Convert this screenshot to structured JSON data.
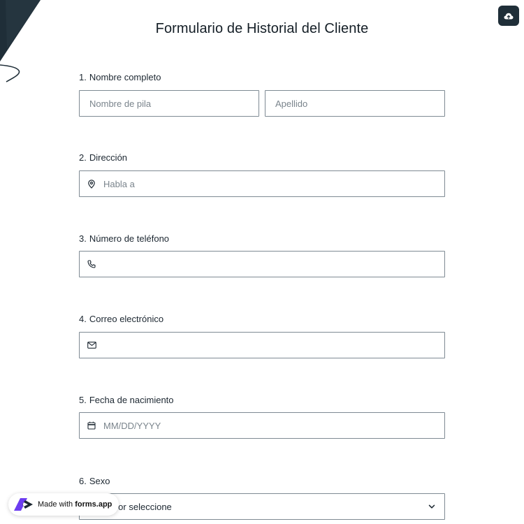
{
  "form": {
    "title": "Formulario de Historial del Cliente",
    "questions": [
      {
        "number": "1.",
        "label": "Nombre completo",
        "first_name_placeholder": "Nombre de pila",
        "last_name_placeholder": "Apellido"
      },
      {
        "number": "2.",
        "label": "Dirección",
        "icon": "location-pin-icon",
        "placeholder": "Habla a"
      },
      {
        "number": "3.",
        "label": "Número de teléfono",
        "icon": "phone-icon",
        "placeholder": ""
      },
      {
        "number": "4.",
        "label": "Correo electrónico",
        "icon": "mail-icon",
        "placeholder": ""
      },
      {
        "number": "5.",
        "label": "Fecha de nacimiento",
        "icon": "calendar-icon",
        "placeholder": "MM/DD/YYYY"
      },
      {
        "number": "6.",
        "label": "Sexo",
        "select_value": "Por favor seleccione"
      }
    ]
  },
  "badge": {
    "prefix": "Made with ",
    "brand": "forms.app"
  },
  "icons": {
    "upload": "cloud-upload-icon"
  },
  "colors": {
    "border": "#7e8a93",
    "dark_button": "#1f2e38",
    "badge_logo": "#6c3cf0",
    "text": "#1c2731"
  }
}
